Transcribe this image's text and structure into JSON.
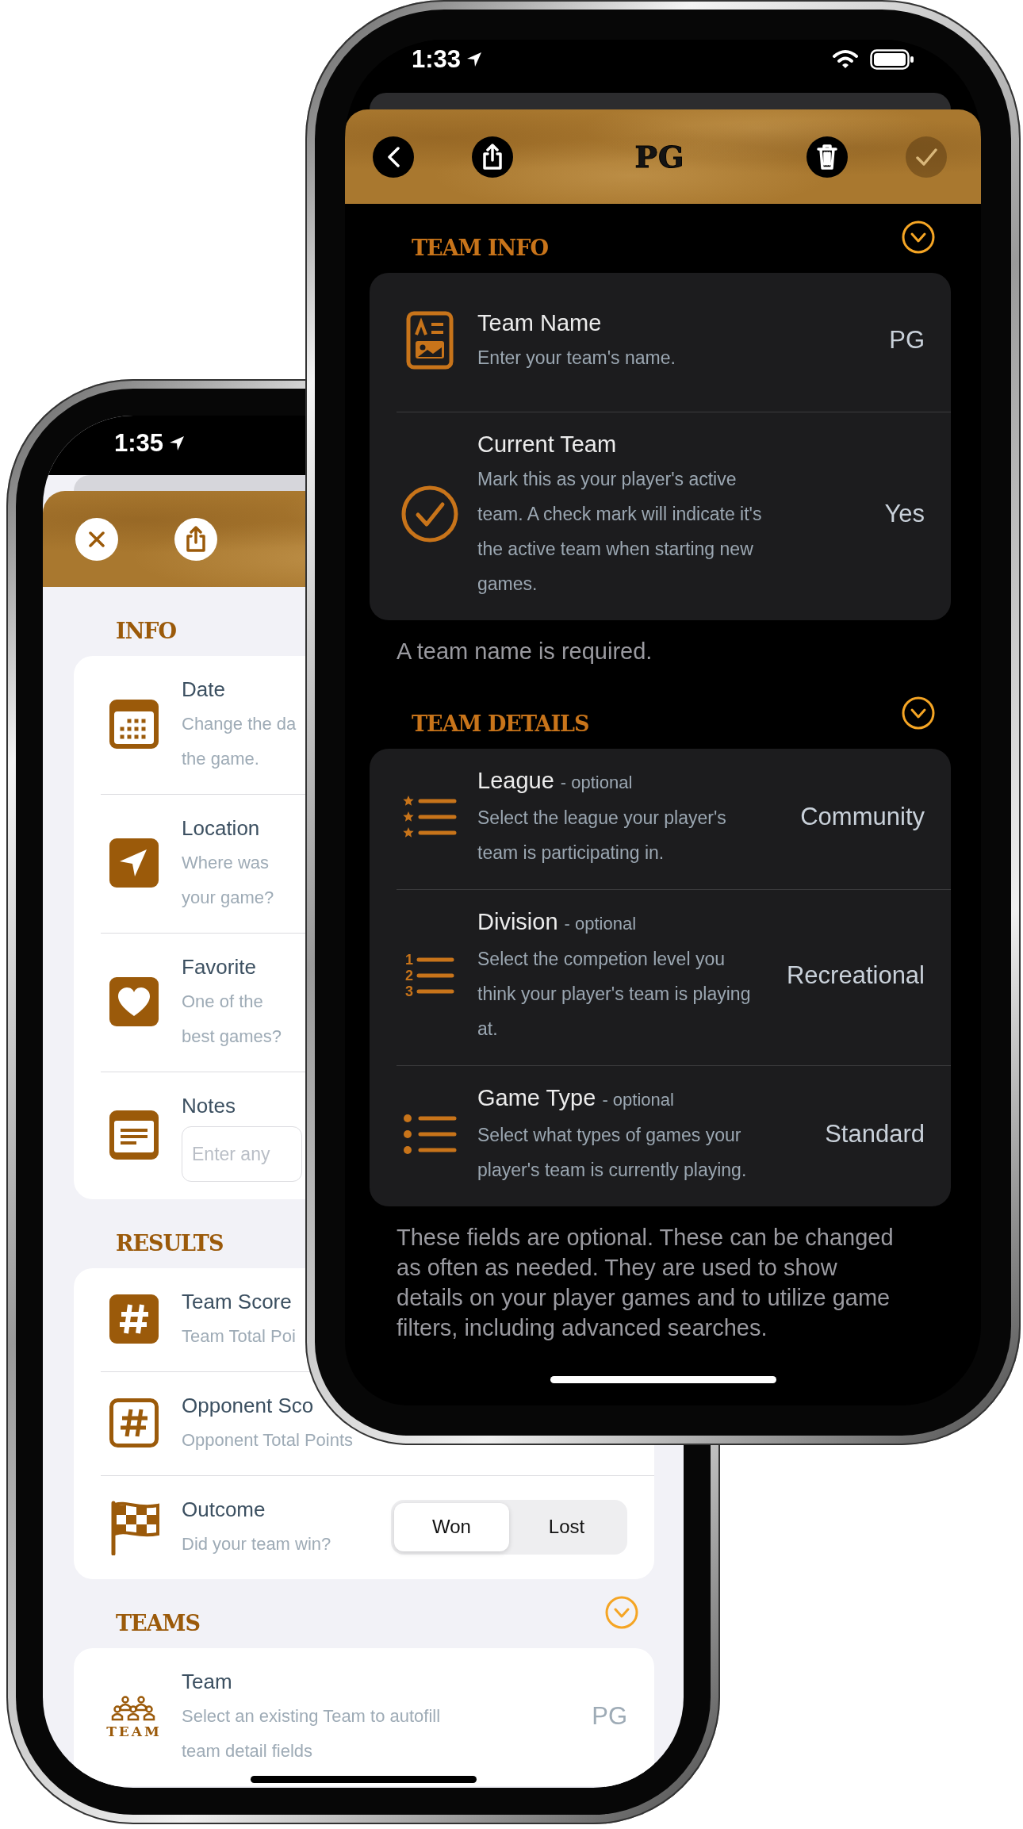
{
  "back_phone": {
    "status_bar": {
      "time": "1:35"
    },
    "toolbar": {
      "left": [
        {
          "disabled": false
        },
        {
          "disabled": false
        }
      ]
    },
    "sections": [
      {
        "title": "INFO",
        "toggle": false,
        "rows": [
          {
            "kind": "info",
            "title": "Date",
            "subtitle_lines": [
              "Change the da",
              "the game."
            ]
          },
          {
            "kind": "info",
            "title": "Location",
            "subtitle_lines": [
              "Where was",
              "your game?"
            ]
          },
          {
            "kind": "info",
            "title": "Favorite",
            "subtitle_lines": [
              "One of the",
              "best games?"
            ]
          },
          {
            "kind": "field",
            "title": "Notes",
            "placeholder": "Enter any"
          }
        ]
      },
      {
        "title": "RESULTS",
        "toggle": false,
        "rows": [
          {
            "kind": "info",
            "title": "Team Score",
            "subtitle_lines": [
              "Team Total Poi"
            ]
          },
          {
            "kind": "info",
            "title": "Opponent Sco",
            "subtitle_lines": [
              "Opponent Total Points"
            ]
          },
          {
            "kind": "segmented",
            "title": "Outcome",
            "subtitle_lines": [
              "Did your team win?"
            ],
            "options": [
              {
                "label": "Won",
                "selected": true
              },
              {
                "label": "Lost",
                "selected": false
              }
            ]
          }
        ]
      },
      {
        "title": "TEAMS",
        "toggle": true,
        "rows": [
          {
            "kind": "value",
            "icon_text": [
              "TEAM"
            ],
            "title": "Team",
            "subtitle_lines": [
              "Select an existing Team to autofill",
              "team detail fields"
            ],
            "value": "PG"
          }
        ]
      }
    ]
  },
  "front_phone": {
    "status_bar": {
      "time": "1:33"
    },
    "toolbar": {
      "left": [
        {
          "disabled": false
        },
        {
          "disabled": false
        }
      ],
      "title": "PG",
      "right": [
        {
          "disabled": false
        },
        {
          "disabled": true
        }
      ]
    },
    "sections": [
      {
        "title": "TEAM INFO",
        "toggle": true,
        "rows": [
          {
            "kind": "value",
            "title": "Team Name",
            "description": "Enter your team's name.",
            "value": "PG"
          },
          {
            "kind": "value",
            "title": "Current Team",
            "description": "Mark this as your player's active team. A check mark will indicate it's the active team when starting new games.",
            "value": "Yes"
          }
        ],
        "footer": "A team name is required."
      },
      {
        "title": "TEAM DETAILS",
        "toggle": true,
        "rows": [
          {
            "kind": "value",
            "title": "League",
            "note": "- optional",
            "description": "Select the league your player's team is participating in.",
            "value": "Community"
          },
          {
            "kind": "value",
            "icon_text": [
              "1",
              "2",
              "3"
            ],
            "title": "Division",
            "note": "- optional",
            "description": "Select the competion level you think your player's team is playing at.",
            "value": "Recreational"
          },
          {
            "kind": "value",
            "title": "Game Type",
            "note": "- optional",
            "description": "Select what types of games your player's team is currently playing.",
            "value": "Standard"
          }
        ],
        "footer": "These fields are optional. These can be changed as often as needed. They are used to show details on your player games and to utilize game filters, including advanced searches."
      }
    ]
  }
}
